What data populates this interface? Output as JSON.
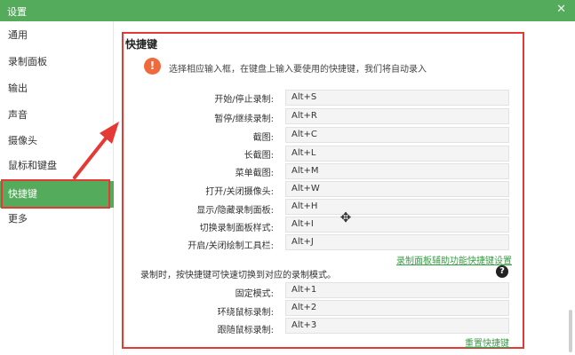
{
  "window": {
    "title": "设置",
    "close_glyph": "✕"
  },
  "sidebar": {
    "items": [
      {
        "label": "通用"
      },
      {
        "label": "录制面板"
      },
      {
        "label": "输出"
      },
      {
        "label": "声音"
      },
      {
        "label": "摄像头"
      },
      {
        "label": "鼠标和键盘"
      },
      {
        "label": "快捷键"
      },
      {
        "label": "更多"
      }
    ],
    "active": "快捷键"
  },
  "shortcuts": {
    "title": "快捷键",
    "hint": "选择相应输入框，在键盘上输入要使用的快捷键，我们将自动录入",
    "rows": [
      {
        "label": "开始/停止录制:",
        "value": "Alt+S"
      },
      {
        "label": "暂停/继续录制:",
        "value": "Alt+R"
      },
      {
        "label": "截图:",
        "value": "Alt+C"
      },
      {
        "label": "长截图:",
        "value": "Alt+L"
      },
      {
        "label": "菜单截图:",
        "value": "Alt+M"
      },
      {
        "label": "打开/关闭摄像头:",
        "value": "Alt+W"
      },
      {
        "label": "显示/隐藏录制面板:",
        "value": "Alt+H"
      },
      {
        "label": "切换录制面板样式:",
        "value": "Alt+I"
      },
      {
        "label": "开启/关闭绘制工具栏:",
        "value": "Alt+J"
      }
    ],
    "panel_link": "录制面板辅助功能快捷键设置",
    "mode_text": "录制时，按快捷键可快速切换到对应的录制模式。",
    "mode_rows": [
      {
        "label": "固定模式:",
        "value": "Alt+1"
      },
      {
        "label": "环绕鼠标录制:",
        "value": "Alt+2"
      },
      {
        "label": "跟随鼠标录制:",
        "value": "Alt+3"
      }
    ],
    "reset_link": "重置快捷键"
  },
  "colors": {
    "accent": "#55ab5c",
    "highlight": "#e53935",
    "warning": "#f06a3c",
    "link": "#3a9b45"
  },
  "icons": {
    "warning": "warning-icon",
    "help": "help-icon",
    "cursor": "move-cursor-icon",
    "close": "close-icon"
  }
}
